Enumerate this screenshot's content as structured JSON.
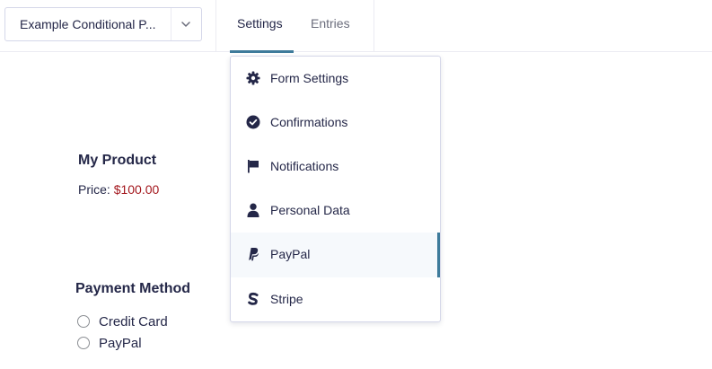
{
  "header": {
    "form_selector": {
      "value": "Example Conditional P...",
      "icon": "chevron-down-icon"
    },
    "tabs": [
      {
        "label": "Settings",
        "active": true
      },
      {
        "label": "Entries",
        "active": false
      }
    ],
    "accent_color": "#3e7b9b"
  },
  "form_preview": {
    "product": {
      "title": "My Product",
      "price_label": "Price:",
      "price_value": "$100.00",
      "price_color": "#a3171d"
    },
    "payment_method": {
      "title": "Payment Method",
      "options": [
        {
          "label": "Credit Card",
          "checked": false
        },
        {
          "label": "PayPal",
          "checked": false
        }
      ]
    }
  },
  "settings_menu": {
    "items": [
      {
        "label": "Form Settings",
        "icon": "gear-icon",
        "active": false
      },
      {
        "label": "Confirmations",
        "icon": "check-circle-icon",
        "active": false
      },
      {
        "label": "Notifications",
        "icon": "flag-icon",
        "active": false
      },
      {
        "label": "Personal Data",
        "icon": "user-icon",
        "active": false
      },
      {
        "label": "PayPal",
        "icon": "paypal-icon",
        "active": true
      },
      {
        "label": "Stripe",
        "icon": "stripe-icon",
        "active": false
      }
    ]
  }
}
